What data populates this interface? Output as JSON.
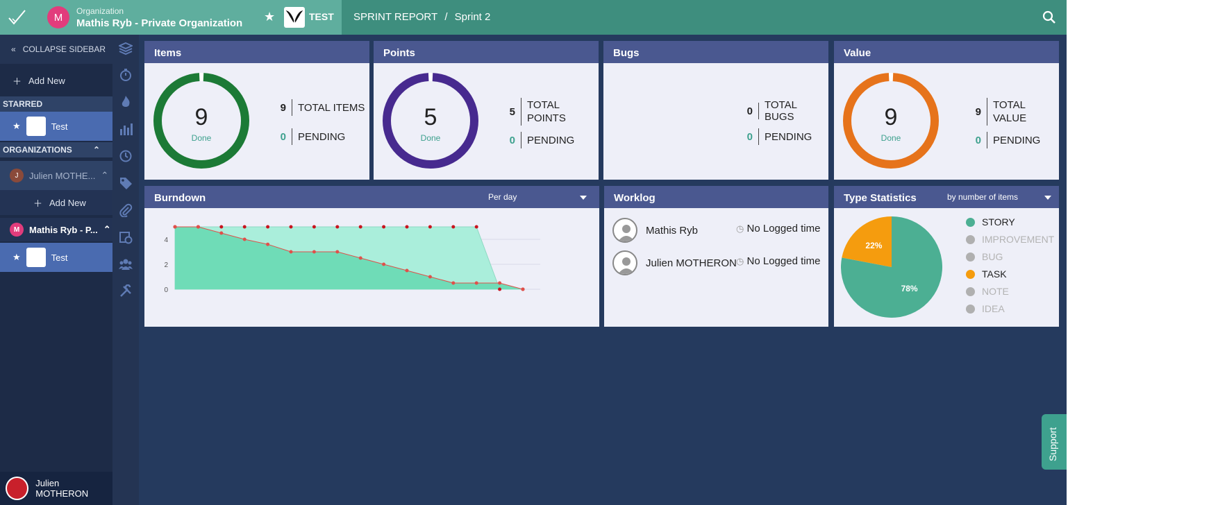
{
  "topbar": {
    "org_avatar": "M",
    "org_label": "Organization",
    "org_name": "Mathis Ryb - Private Organization",
    "project_name": "TEST",
    "breadcrumb_report": "SPRINT REPORT",
    "breadcrumb_sep": "/",
    "breadcrumb_sprint": "Sprint 2"
  },
  "sidebar": {
    "collapse_label": "COLLAPSE SIDEBAR",
    "add_new_label": "Add New",
    "starred_heading": "STARRED",
    "starred_project": "Test",
    "organizations_heading": "ORGANIZATIONS",
    "org_julien_avatar": "J",
    "org_julien": "Julien MOTHE...",
    "org_add_new": "Add New",
    "org_mathis_avatar": "M",
    "org_mathis": "Mathis Ryb - P...",
    "org_mathis_project": "Test",
    "user_name": "Julien MOTHERON"
  },
  "rail_icons": [
    "layers-icon",
    "stopwatch-icon",
    "flame-icon",
    "bar-chart-icon",
    "history-icon",
    "tag-icon",
    "paperclip-icon",
    "calendar-clock-icon",
    "team-icon",
    "tools-icon"
  ],
  "cards": {
    "items": {
      "title": "Items",
      "done_count": "9",
      "done_label": "Done",
      "total": "9",
      "total_label": "TOTAL ITEMS",
      "pending": "0",
      "pending_label": "PENDING",
      "done_fraction": 1.0
    },
    "points": {
      "title": "Points",
      "done_count": "5",
      "done_label": "Done",
      "total": "5",
      "total_label_1": "TOTAL",
      "total_label_2": "POINTS",
      "pending": "0",
      "pending_label": "PENDING",
      "done_fraction": 1.0
    },
    "bugs": {
      "title": "Bugs",
      "total": "0",
      "total_label": "TOTAL BUGS",
      "pending": "0",
      "pending_label": "PENDING"
    },
    "value": {
      "title": "Value",
      "done_count": "9",
      "done_label": "Done",
      "total": "9",
      "total_label_1": "TOTAL",
      "total_label_2": "VALUE",
      "pending": "0",
      "pending_label": "PENDING",
      "done_fraction": 1.0
    },
    "burndown": {
      "title": "Burndown",
      "dropdown": "Per day"
    },
    "worklog": {
      "title": "Worklog",
      "rows": [
        {
          "name": "Mathis Ryb",
          "time": "No Logged time"
        },
        {
          "name": "Julien MOTHERON",
          "time": "No Logged time"
        }
      ]
    },
    "type_stats": {
      "title": "Type Statistics",
      "dropdown": "by number of items",
      "legend": [
        {
          "label": "STORY",
          "color": "#4caf93",
          "active": true
        },
        {
          "label": "IMPROVEMENT",
          "color": "#b0b0b0",
          "active": false
        },
        {
          "label": "BUG",
          "color": "#b0b0b0",
          "active": false
        },
        {
          "label": "TASK",
          "color": "#f59c0e",
          "active": true
        },
        {
          "label": "NOTE",
          "color": "#b0b0b0",
          "active": false
        },
        {
          "label": "IDEA",
          "color": "#b0b0b0",
          "active": false
        }
      ]
    }
  },
  "support_label": "Support",
  "colors": {
    "items_ring": "#1c7a36",
    "points_ring": "#472a8f",
    "value_ring": "#e6731b",
    "done_text": "#3ea18e",
    "burndown_fill_ideal": "#aaeedb",
    "burndown_fill_actual": "#6fdcb7",
    "burndown_line": "#e0504a"
  },
  "chart_data": [
    {
      "type": "area",
      "title": "Burndown",
      "ylim": [
        0,
        5
      ],
      "yticks": [
        0,
        2,
        4
      ],
      "series": [
        {
          "values": [
            5,
            5,
            5,
            5,
            5,
            5,
            5,
            5,
            5,
            5,
            5,
            5,
            5,
            5,
            0,
            0
          ]
        },
        {
          "values": [
            5,
            5,
            4.5,
            4,
            3.6,
            3,
            3,
            3,
            2.5,
            2,
            1.5,
            1,
            0.5,
            0.5,
            0.5,
            0
          ]
        }
      ]
    },
    {
      "type": "pie",
      "title": "Type Statistics",
      "labels": [
        "STORY",
        "TASK"
      ],
      "values": [
        78,
        22
      ],
      "value_labels": [
        "78%",
        "22%"
      ]
    }
  ]
}
